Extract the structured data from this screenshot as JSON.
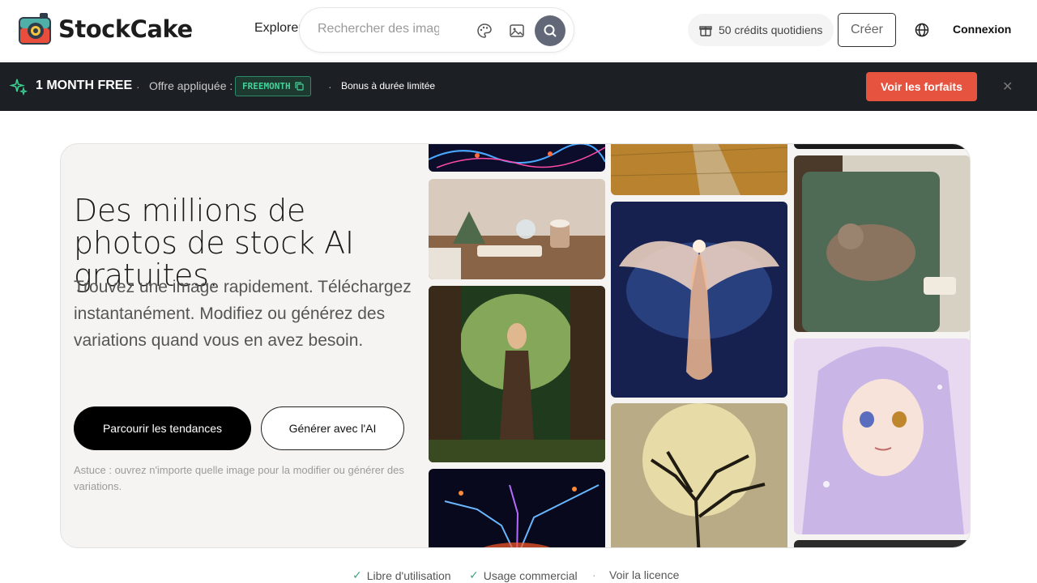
{
  "brand": {
    "name": "StockCake"
  },
  "nav": {
    "explore_label": "Explorer"
  },
  "search": {
    "placeholder": "Rechercher des images",
    "value": ""
  },
  "header": {
    "credits_label": "50 crédits quotidiens",
    "create_label": "Créer",
    "login_label": "Connexion"
  },
  "promo": {
    "title": "1 MONTH FREE",
    "applied_label": "Offre appliquée :",
    "code": "FREEMONTH",
    "bonus": "Bonus à durée limitée",
    "cta": "Voir les forfaits"
  },
  "hero": {
    "title": "Des millions de photos de stock AI gratuites.",
    "subtitle": "Trouvez une image rapidement. Téléchargez instantanément. Modifiez ou générez des variations quand vous en avez besoin.",
    "primary_cta": "Parcourir les tendances",
    "secondary_cta": "Générer avec l'AI",
    "tip": "Astuce : ouvrez n'importe quelle image pour la modifier ou générer des variations."
  },
  "gallery": {
    "images": [
      "electric-neurons",
      "cozy-table-books",
      "forest-warrior",
      "lightning-burst",
      "wheat-field-path",
      "cosmic-phoenix",
      "moon-tree-silhouette",
      "cat-on-armchair",
      "anime-girl"
    ]
  },
  "footer": {
    "free_use": "Libre d'utilisation",
    "commercial": "Usage commercial",
    "license": "Voir la licence"
  },
  "colors": {
    "accent": "#e6533f",
    "promo_bg": "#1c1f24",
    "code_green": "#41d39a",
    "search_btn": "#626877"
  }
}
